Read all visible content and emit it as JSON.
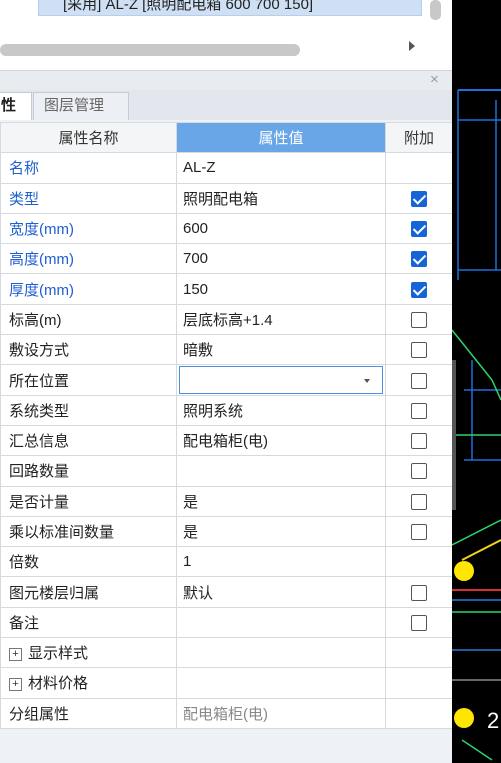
{
  "top": {
    "selected_item": "[采用] AL-Z [照明配电箱 600 700 150]"
  },
  "tabs": {
    "properties": "性",
    "layers": "图层管理"
  },
  "table": {
    "headers": {
      "name": "属性名称",
      "value": "属性值",
      "extra": "附加"
    },
    "rows": [
      {
        "name": "名称",
        "value": "AL-Z",
        "checkbox": null
      },
      {
        "name": "类型",
        "value": "照明配电箱",
        "checkbox": true
      },
      {
        "name": "宽度(mm)",
        "value": "600",
        "checkbox": true
      },
      {
        "name": "高度(mm)",
        "value": "700",
        "checkbox": true
      },
      {
        "name": "厚度(mm)",
        "value": "150",
        "checkbox": true
      },
      {
        "name": "标高(m)",
        "value": "层底标高+1.4",
        "checkbox": false
      },
      {
        "name": "敷设方式",
        "value": "暗敷",
        "checkbox": false
      },
      {
        "name": "所在位置",
        "value": "",
        "checkbox": false
      },
      {
        "name": "系统类型",
        "value": "照明系统",
        "checkbox": false
      },
      {
        "name": "汇总信息",
        "value": "配电箱柜(电)",
        "checkbox": false
      },
      {
        "name": "回路数量",
        "value": "",
        "checkbox": false
      },
      {
        "name": "是否计量",
        "value": "是",
        "checkbox": false
      },
      {
        "name": "乘以标准间数量",
        "value": "是",
        "checkbox": false
      },
      {
        "name": "倍数",
        "value": "1",
        "checkbox": null
      },
      {
        "name": "图元楼层归属",
        "value": "默认",
        "checkbox": false
      },
      {
        "name": "备注",
        "value": "",
        "checkbox": false
      },
      {
        "name": "显示样式",
        "value": "",
        "checkbox": null
      },
      {
        "name": "材料价格",
        "value": "",
        "checkbox": null
      },
      {
        "name": "分组属性",
        "value": "配电箱柜(电)",
        "checkbox": null
      }
    ]
  },
  "cad": {
    "label": "2"
  },
  "colors": {
    "accent_header": "#68a6e8",
    "checkbox_checked": "#1565d8",
    "blue_label": "#1f5fd0"
  }
}
